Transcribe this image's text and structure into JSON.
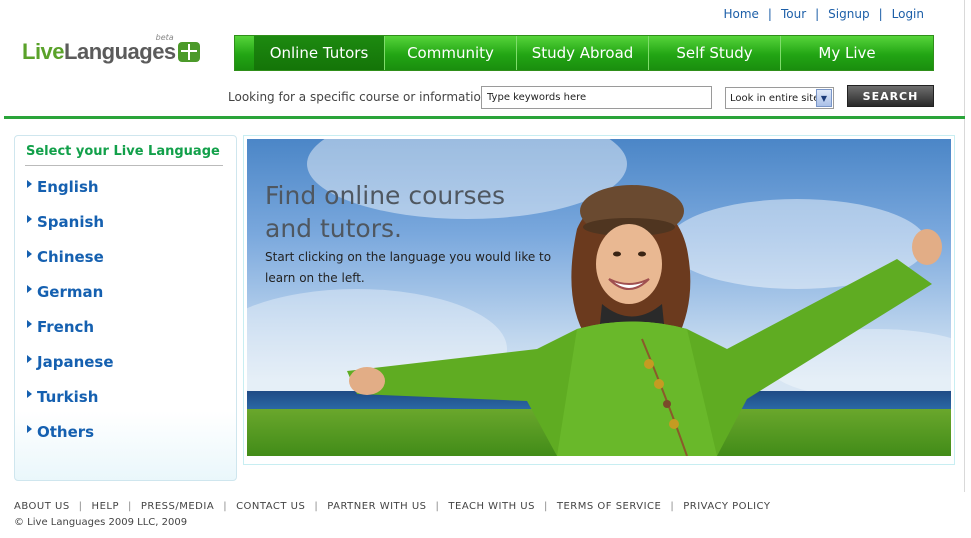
{
  "toplinks": {
    "home": "Home",
    "tour": "Tour",
    "signup": "Signup",
    "login": "Login",
    "sep": "|"
  },
  "logo": {
    "part1": "Live",
    "part2": "Languages",
    "beta": "beta"
  },
  "nav": [
    {
      "label": "Online Tutors",
      "active": true
    },
    {
      "label": "Community"
    },
    {
      "label": "Study Abroad"
    },
    {
      "label": "Self Study"
    },
    {
      "label": "My Live"
    }
  ],
  "search": {
    "label": "Looking for a specific course or information?",
    "value": "Type keywords here",
    "scope": "Look in entire site",
    "button": "SEARCH"
  },
  "sidebar": {
    "title": "Select your Live Language",
    "languages": [
      "English",
      "Spanish",
      "Chinese",
      "German",
      "French",
      "Japanese",
      "Turkish",
      "Others"
    ]
  },
  "hero": {
    "headline1": "Find online courses",
    "headline2": "and tutors.",
    "body": "Start clicking on the language you would like to learn on the left."
  },
  "footer": {
    "links": [
      "ABOUT US",
      "HELP",
      "PRESS/MEDIA",
      "CONTACT US",
      "PARTNER WITH US",
      "TEACH WITH US",
      "TERMS OF SERVICE",
      "PRIVACY POLICY"
    ],
    "sep": "|",
    "copyright": "© Live Languages 2009 LLC, 2009"
  },
  "colors": {
    "brand_green": "#22a514",
    "link_blue": "#1560b0",
    "accent_green": "#12a04a"
  }
}
